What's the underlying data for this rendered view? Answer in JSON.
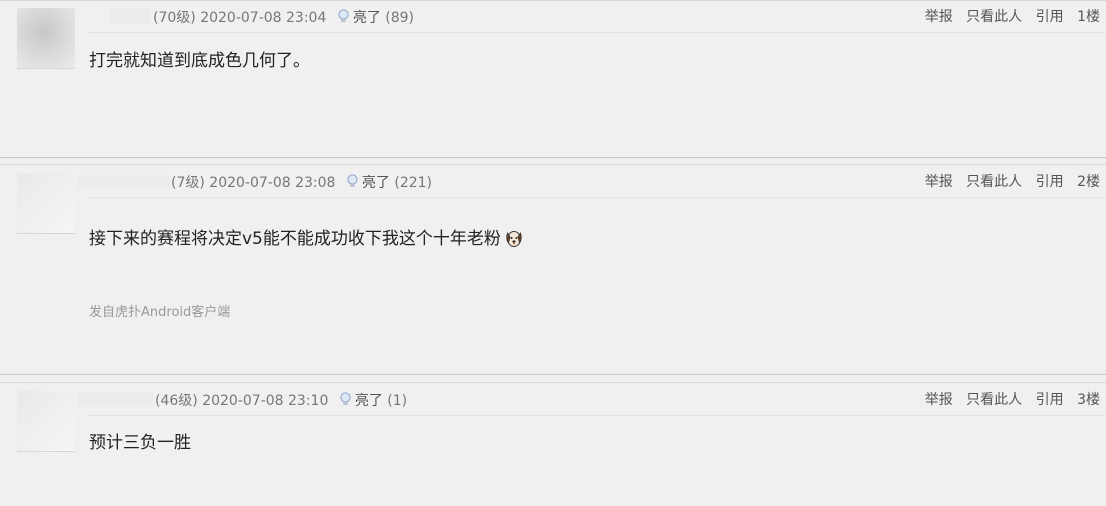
{
  "posts": [
    {
      "level": "(70级)",
      "time": "2020-07-08 23:04",
      "light_label": "亮了",
      "light_count": "(89)",
      "content": "打完就知道到底成色几何了。",
      "actions": {
        "report": "举报",
        "only_author": "只看此人",
        "quote": "引用",
        "floor": "1楼"
      }
    },
    {
      "level": "(7级)",
      "time": "2020-07-08 23:08",
      "light_label": "亮了",
      "light_count": "(221)",
      "content": "接下来的赛程将决定v5能不能成功收下我这个十年老粉",
      "source": "发自虎扑Android客户端",
      "actions": {
        "report": "举报",
        "only_author": "只看此人",
        "quote": "引用",
        "floor": "2楼"
      }
    },
    {
      "level": "(46级)",
      "time": "2020-07-08 23:10",
      "light_label": "亮了",
      "light_count": "(1)",
      "content": "预计三负一胜",
      "actions": {
        "report": "举报",
        "only_author": "只看此人",
        "quote": "引用",
        "floor": "3楼"
      }
    }
  ]
}
